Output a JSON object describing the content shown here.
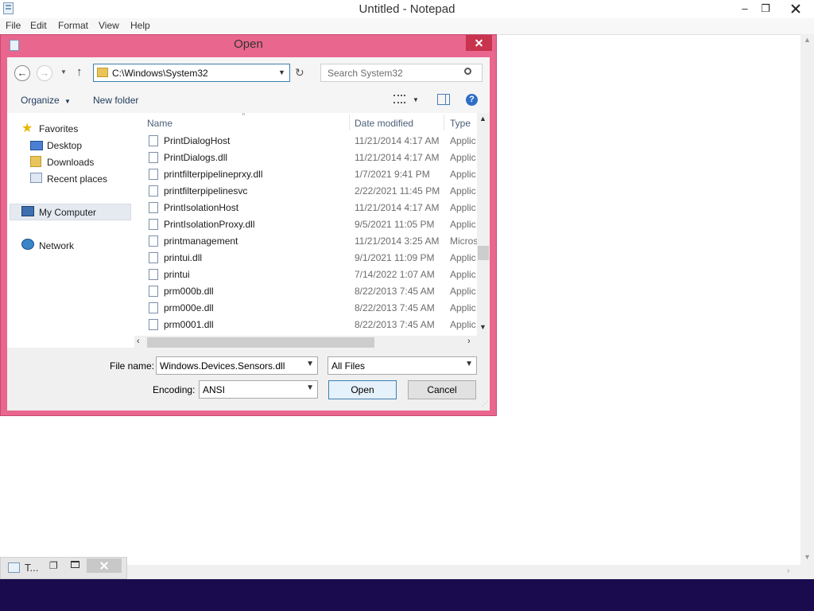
{
  "notepad": {
    "title": "Untitled - Notepad",
    "menu": [
      "File",
      "Edit",
      "Format",
      "View",
      "Help"
    ],
    "minimize": "–",
    "restore": "❐"
  },
  "dialog": {
    "title": "Open",
    "address": "C:\\Windows\\System32",
    "search_placeholder": "Search System32",
    "toolbar": {
      "organize": "Organize",
      "new_folder": "New folder"
    },
    "nav": {
      "favorites": "Favorites",
      "desktop": "Desktop",
      "downloads": "Downloads",
      "recent": "Recent places",
      "my_computer": "My Computer",
      "network": "Network"
    },
    "columns": {
      "name": "Name",
      "date": "Date modified",
      "type": "Type"
    },
    "files": [
      {
        "name": "PrintDialogHost",
        "date": "11/21/2014 4:17 AM",
        "type": "Applic"
      },
      {
        "name": "PrintDialogs.dll",
        "date": "11/21/2014 4:17 AM",
        "type": "Applic"
      },
      {
        "name": "printfilterpipelineprxy.dll",
        "date": "1/7/2021 9:41 PM",
        "type": "Applic"
      },
      {
        "name": "printfilterpipelinesvc",
        "date": "2/22/2021 11:45 PM",
        "type": "Applic"
      },
      {
        "name": "PrintIsolationHost",
        "date": "11/21/2014 4:17 AM",
        "type": "Applic"
      },
      {
        "name": "PrintIsolationProxy.dll",
        "date": "9/5/2021 11:05 PM",
        "type": "Applic"
      },
      {
        "name": "printmanagement",
        "date": "11/21/2014 3:25 AM",
        "type": "Micros"
      },
      {
        "name": "printui.dll",
        "date": "9/1/2021 11:09 PM",
        "type": "Applic"
      },
      {
        "name": "printui",
        "date": "7/14/2022 1:07 AM",
        "type": "Applic"
      },
      {
        "name": "prm000b.dll",
        "date": "8/22/2013 7:45 AM",
        "type": "Applic"
      },
      {
        "name": "prm000e.dll",
        "date": "8/22/2013 7:45 AM",
        "type": "Applic"
      },
      {
        "name": "prm0001.dll",
        "date": "8/22/2013 7:45 AM",
        "type": "Applic"
      }
    ],
    "file_name_label": "File name:",
    "file_name_value": "Windows.Devices.Sensors.dll",
    "file_type_value": "All Files",
    "encoding_label": "Encoding:",
    "encoding_value": "ANSI",
    "open_button": "Open",
    "cancel_button": "Cancel"
  },
  "taskbar": {
    "mini_title": "T..."
  }
}
